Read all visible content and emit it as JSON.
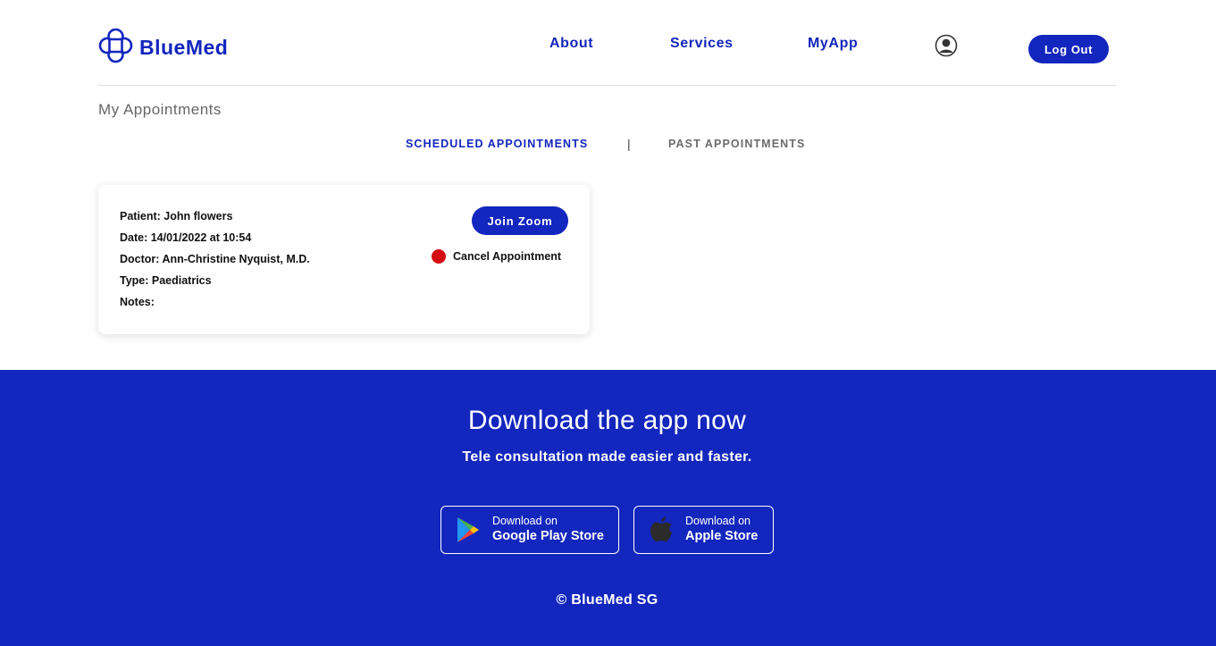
{
  "brand": {
    "name": "BlueMed",
    "color": "#1326bd"
  },
  "nav": {
    "about": "About",
    "services": "Services",
    "myapp": "MyApp",
    "logout": "Log Out"
  },
  "page": {
    "title": "My Appointments"
  },
  "tabs": {
    "scheduled": "SCHEDULED APPOINTMENTS",
    "divider": "|",
    "past": "PAST APPOINTMENTS",
    "active": "scheduled"
  },
  "appointment": {
    "patient": "Patient: John flowers",
    "date": "Date: 14/01/2022 at 10:54",
    "doctor": "Doctor: Ann-Christine Nyquist, M.D.",
    "type": "Type: Paediatrics",
    "notes": "Notes:",
    "join_label": "Join Zoom",
    "cancel_label": "Cancel Appointment",
    "cancel_color": "#d40d14"
  },
  "footer": {
    "title": "Download the app now",
    "subtitle": "Tele consultation made easier and faster.",
    "google": {
      "small": "Download on",
      "big": "Google Play Store",
      "icon": "google-play-icon"
    },
    "apple": {
      "small": "Download on",
      "big": "Apple Store",
      "icon": "apple-icon"
    },
    "copyright": "© BlueMed SG"
  }
}
